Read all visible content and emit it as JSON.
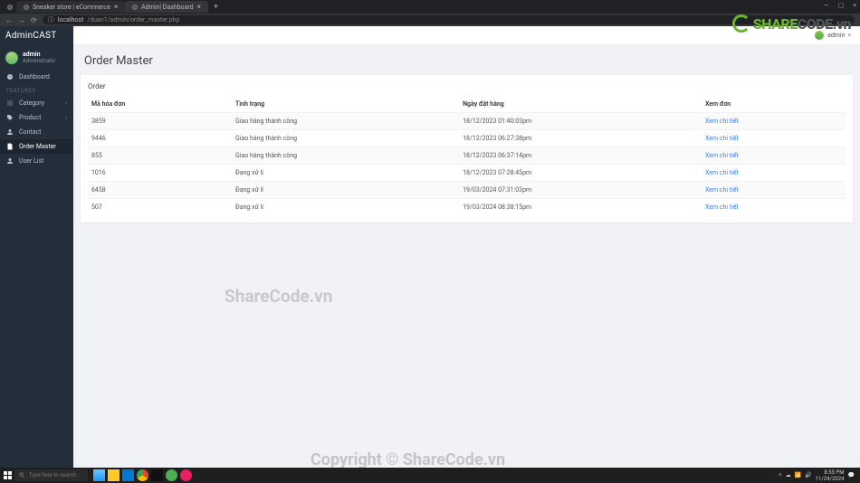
{
  "browser": {
    "tabs": [
      {
        "title": "Sneaker store | eCommerce"
      },
      {
        "title": "Admin| Dashboard"
      }
    ],
    "url_prefix": "localhost",
    "url_path": "/duan1/admin/order_master.php"
  },
  "topbar": {
    "user": "admin"
  },
  "sidebar": {
    "brand": "AdminCAST",
    "user_name": "admin",
    "user_role": "Administrator",
    "dashboard": "Dashboard",
    "features_heading": "FEATURES",
    "items": [
      {
        "label": "Category",
        "expandable": true
      },
      {
        "label": "Product",
        "expandable": true
      },
      {
        "label": "Contact",
        "expandable": false
      },
      {
        "label": "Order Master",
        "expandable": false
      },
      {
        "label": "User List",
        "expandable": false
      }
    ]
  },
  "page": {
    "title": "Order Master",
    "card_title": "Order",
    "table": {
      "headers": [
        "Mã hóa đơn",
        "Tình trạng",
        "Ngày đặt hàng",
        "Xem đơn"
      ],
      "detail_link": "Xem chi tiết",
      "rows": [
        {
          "id": "3859",
          "status": "Giao hàng thành công",
          "date": "18/12/2023 01:40:03pm"
        },
        {
          "id": "9446",
          "status": "Giao hàng thành công",
          "date": "18/12/2023 06:27:38pm"
        },
        {
          "id": "855",
          "status": "Giao hàng thành công",
          "date": "18/12/2023 06:37:14pm"
        },
        {
          "id": "1016",
          "status": "Đang xử lí",
          "date": "18/12/2023 07:28:45pm"
        },
        {
          "id": "6458",
          "status": "Đang xử lí",
          "date": "19/03/2024 07:31:03pm"
        },
        {
          "id": "507",
          "status": "Đang xử lí",
          "date": "19/03/2024 08:38:15pm"
        }
      ]
    }
  },
  "watermarks": {
    "center": "ShareCode.vn",
    "bottom": "Copyright © ShareCode.vn",
    "logo_a": "SHARE",
    "logo_b": "CODE.vn"
  },
  "taskbar": {
    "search_placeholder": "Type here to search",
    "time": "8:55 PM",
    "date": "11/24/2024"
  }
}
